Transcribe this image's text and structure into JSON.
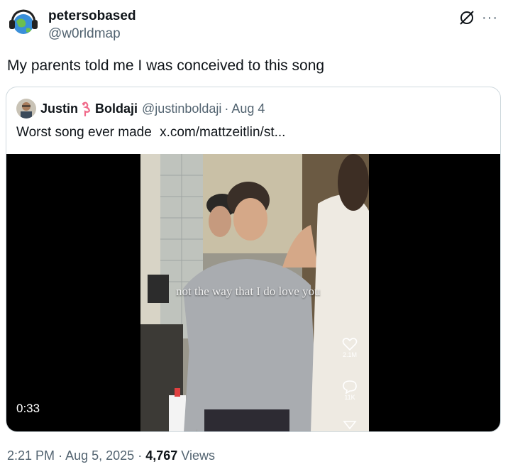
{
  "post": {
    "display_name": "petersobased",
    "handle": "@w0rldmap",
    "text": "My parents told me I was conceived to this song",
    "more_icon": "more-icon",
    "grok_icon": "grok-icon"
  },
  "quote": {
    "name_first": "Justin",
    "name_last": "Boldaji",
    "name_emoji_icon": "flamingo-icon",
    "handle": "@justinboldaji",
    "separator": "·",
    "date": "Aug 4",
    "text": "Worst song ever made",
    "link": "x.com/mattzeitlin/st..."
  },
  "video": {
    "caption": "not the way that I do love you",
    "duration": "0:33",
    "likes": "2.1M",
    "comments": "11K"
  },
  "footer": {
    "time": "2:21 PM",
    "sep1": "·",
    "date": "Aug 5, 2025",
    "sep2": "·",
    "views_count": "4,767",
    "views_label": "Views"
  }
}
